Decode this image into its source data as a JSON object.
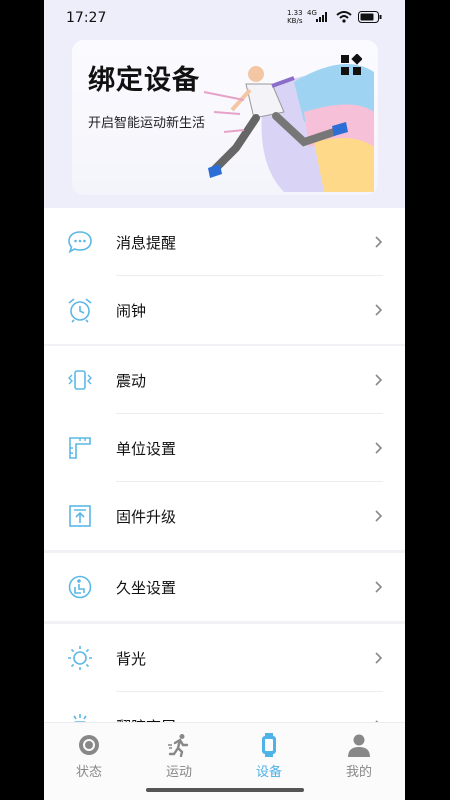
{
  "status_bar": {
    "time": "17:27",
    "net_speed_value": "1.33",
    "net_speed_unit": "KB/s",
    "network": "4G",
    "battery_icon": "battery-icon",
    "wifi_icon": "wifi-icon",
    "signal_icon": "signal-icon"
  },
  "header": {
    "title": "绑定设备",
    "subtitle": "开启智能运动新生活",
    "qr_icon": "qr-code-icon"
  },
  "menu_groups": [
    {
      "items": [
        {
          "label": "消息提醒",
          "icon": "message-icon"
        },
        {
          "label": "闹钟",
          "icon": "alarm-clock-icon"
        }
      ]
    },
    {
      "items": [
        {
          "label": "震动",
          "icon": "vibration-icon"
        },
        {
          "label": "单位设置",
          "icon": "ruler-icon"
        },
        {
          "label": "固件升级",
          "icon": "upgrade-icon"
        }
      ]
    },
    {
      "items": [
        {
          "label": "久坐设置",
          "icon": "sedentary-icon"
        }
      ]
    },
    {
      "items": [
        {
          "label": "背光",
          "icon": "sun-icon"
        },
        {
          "label": "翻腕亮屏",
          "icon": "wrist-icon"
        }
      ]
    }
  ],
  "bottom_nav": [
    {
      "label": "状态",
      "icon": "status-icon",
      "active": false
    },
    {
      "label": "运动",
      "icon": "run-icon",
      "active": false
    },
    {
      "label": "设备",
      "icon": "watch-icon",
      "active": true
    },
    {
      "label": "我的",
      "icon": "person-icon",
      "active": false
    }
  ],
  "colors": {
    "accent": "#4fb2e8",
    "icon": "#5bb8e6",
    "header_bg": "#eeeefb",
    "page_bg": "#f1f1f6"
  }
}
